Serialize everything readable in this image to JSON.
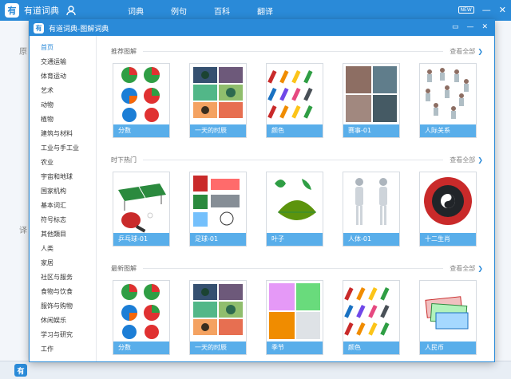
{
  "app": {
    "title": "有道词典",
    "nav": [
      "词典",
      "例句",
      "百科",
      "翻译"
    ],
    "badge": "NEW",
    "minimize": "—",
    "close": "✕"
  },
  "background": {
    "text1": "原",
    "text2": "译"
  },
  "dialog": {
    "title": "有道词典-图解词典",
    "ctrl_menu": "▭",
    "ctrl_min": "—",
    "ctrl_close": "✕"
  },
  "sidebar": {
    "items": [
      {
        "label": "首页"
      },
      {
        "label": "交通运输"
      },
      {
        "label": "体育运动"
      },
      {
        "label": "艺术"
      },
      {
        "label": "动物"
      },
      {
        "label": "植物"
      },
      {
        "label": "建筑与材料"
      },
      {
        "label": "工业与手工业"
      },
      {
        "label": "农业"
      },
      {
        "label": "宇宙和地球"
      },
      {
        "label": "国家机构"
      },
      {
        "label": "基本词汇"
      },
      {
        "label": "符号标志"
      },
      {
        "label": "其他類目"
      },
      {
        "label": "人类"
      },
      {
        "label": "家居"
      },
      {
        "label": "社区与服务"
      },
      {
        "label": "食物与饮食"
      },
      {
        "label": "服饰与购物"
      },
      {
        "label": "休闲娱乐"
      },
      {
        "label": "学习与研究"
      },
      {
        "label": "工作"
      }
    ]
  },
  "sections": [
    {
      "title": "推荐图解",
      "more": "查看全部",
      "cards": [
        {
          "label": "分数",
          "icon": "fraction-pie-image"
        },
        {
          "label": "一天的时辰",
          "icon": "tree-daytime-image"
        },
        {
          "label": "颜色",
          "icon": "crayons-image"
        },
        {
          "label": "赛事-01",
          "icon": "sports-event-image"
        },
        {
          "label": "人际关系",
          "icon": "people-relation-image"
        }
      ]
    },
    {
      "title": "时下热门",
      "more": "查看全部",
      "cards": [
        {
          "label": "乒乓球-01",
          "icon": "ping-pong-image"
        },
        {
          "label": "足球-01",
          "icon": "football-image"
        },
        {
          "label": "叶子",
          "icon": "leaves-image"
        },
        {
          "label": "人体-01",
          "icon": "human-body-image"
        },
        {
          "label": "十二生肖",
          "icon": "zodiac-wheel-image"
        }
      ]
    },
    {
      "title": "最新图解",
      "more": "查看全部",
      "cards": [
        {
          "label": "分数",
          "icon": "fraction-pie-image"
        },
        {
          "label": "一天的时辰",
          "icon": "tree-daytime-image"
        },
        {
          "label": "季节",
          "icon": "seasons-image"
        },
        {
          "label": "颜色",
          "icon": "crayons-image"
        },
        {
          "label": "人民币",
          "icon": "banknotes-image"
        }
      ]
    }
  ]
}
